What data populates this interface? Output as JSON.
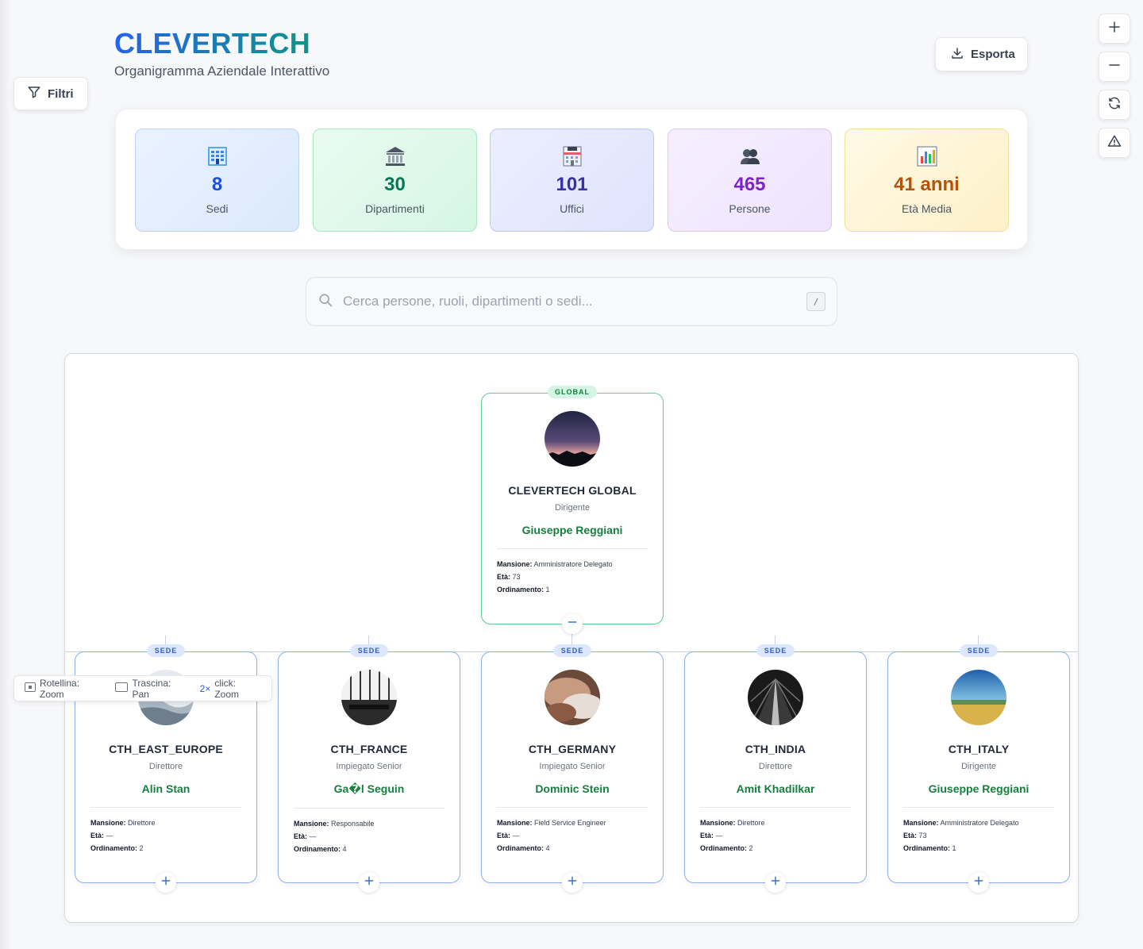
{
  "header": {
    "title": "CLEVERTECH",
    "subtitle": "Organigramma Aziendale Interattivo",
    "filters_label": "Filtri",
    "export_label": "Esporta"
  },
  "zoom_controls": [
    {
      "icon": "plus-icon",
      "name": "zoom-in-button"
    },
    {
      "icon": "minus-icon",
      "name": "zoom-out-button"
    },
    {
      "icon": "refresh-icon",
      "name": "reset-view-button"
    },
    {
      "icon": "warning-icon",
      "name": "alerts-button"
    }
  ],
  "stats": [
    {
      "icon": "building-icon",
      "value": "8",
      "label": "Sedi",
      "color": "#1d4ed8"
    },
    {
      "icon": "bank-icon",
      "value": "30",
      "label": "Dipartimenti",
      "color": "#047857"
    },
    {
      "icon": "calendar-icon",
      "value": "101",
      "label": "Uffici",
      "color": "#3730a3"
    },
    {
      "icon": "people-icon",
      "value": "465",
      "label": "Persone",
      "color": "#7e22ce"
    },
    {
      "icon": "chart-icon",
      "value": "41 anni",
      "label": "Età Media",
      "color": "#b45309"
    }
  ],
  "search": {
    "placeholder": "Cerca persone, ruoli, dipartimenti o sedi...",
    "shortcut": "/"
  },
  "labels": {
    "mansione": "Mansione:",
    "eta": "Età:",
    "ordinamento": "Ordinamento:"
  },
  "root": {
    "badge": "GLOBAL",
    "name": "CLEVERTECH GLOBAL",
    "role": "Dirigente",
    "person": "Giuseppe Reggiani",
    "mansione": "Amministratore Delegato",
    "eta": "73",
    "ordinamento": "1"
  },
  "children": [
    {
      "badge": "SEDE",
      "name": "CTH_EAST_EUROPE",
      "role": "Direttore",
      "person": "Alin Stan",
      "mansione": "Direttore",
      "eta": "—",
      "ordinamento": "2"
    },
    {
      "badge": "SEDE",
      "name": "CTH_FRANCE",
      "role": "Impiegato Senior",
      "person": "Ga�l Seguin",
      "mansione": "Responsabile",
      "eta": "—",
      "ordinamento": "4"
    },
    {
      "badge": "SEDE",
      "name": "CTH_GERMANY",
      "role": "Impiegato Senior",
      "person": "Dominic Stein",
      "mansione": "Field Service Engineer",
      "eta": "—",
      "ordinamento": "4"
    },
    {
      "badge": "SEDE",
      "name": "CTH_INDIA",
      "role": "Direttore",
      "person": "Amit Khadilkar",
      "mansione": "Direttore",
      "eta": "—",
      "ordinamento": "2"
    },
    {
      "badge": "SEDE",
      "name": "CTH_ITALY",
      "role": "Dirigente",
      "person": "Giuseppe Reggiani",
      "mansione": "Amministratore Delegato",
      "eta": "73",
      "ordinamento": "1"
    }
  ],
  "hint": {
    "wheel": "Rotellina: Zoom",
    "drag": "Trascina: Pan",
    "dbl_key": "2×",
    "dbl": "click: Zoom"
  }
}
